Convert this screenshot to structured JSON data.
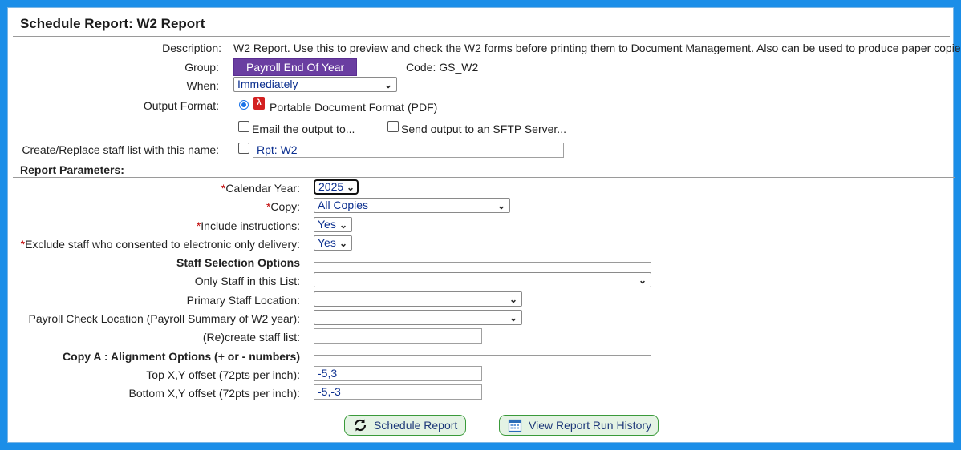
{
  "header": {
    "title": "Schedule Report: W2 Report"
  },
  "form": {
    "description_label": "Description:",
    "description": "W2 Report. Use this to preview and check the W2 forms before printing them to Document Management. Also can be used to produce paper copies.",
    "group_label": "Group:",
    "group_value": "Payroll End Of Year",
    "code_text": "Code: GS_W2",
    "when_label": "When:",
    "when_value": "Immediately",
    "output_format_label": "Output Format:",
    "output_format_value": "Portable Document Format (PDF)",
    "email_label": "Email the output to...",
    "sftp_label": "Send output to an SFTP Server...",
    "staff_list_label": "Create/Replace staff list with this name:",
    "staff_list_value": "Rpt: W2"
  },
  "params": {
    "section_title": "Report Parameters:",
    "calendar_year_label": "Calendar Year:",
    "calendar_year_value": "2025",
    "copy_label": "Copy:",
    "copy_value": "All Copies",
    "include_instructions_label": "Include instructions:",
    "include_instructions_value": "Yes",
    "exclude_staff_label": "Exclude staff who consented to electronic only delivery:",
    "exclude_staff_value": "Yes",
    "staff_selection_title": "Staff Selection Options",
    "only_staff_label": "Only Staff in this List:",
    "only_staff_value": "",
    "primary_location_label": "Primary Staff Location:",
    "primary_location_value": "",
    "payroll_check_label": "Payroll Check Location (Payroll Summary of W2 year):",
    "payroll_check_value": "",
    "recreate_label": "(Re)create staff list:",
    "recreate_value": "",
    "copy_a_title": "Copy A : Alignment Options (+ or - numbers)",
    "top_offset_label": "Top X,Y offset (72pts per inch):",
    "top_offset_value": "-5,3",
    "bottom_offset_label": "Bottom X,Y offset (72pts per inch):",
    "bottom_offset_value": "-5,-3",
    "required_mark": "*"
  },
  "buttons": {
    "schedule": "Schedule Report",
    "history": "View Report Run History"
  },
  "colors": {
    "background": "#1b8ee8",
    "group_tag": "#6a3ea1",
    "button_bg": "#e4f3e4",
    "required": "#c00000"
  }
}
